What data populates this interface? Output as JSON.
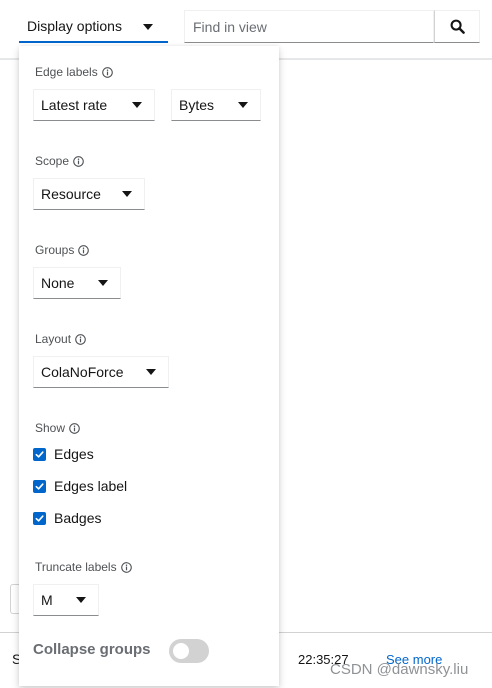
{
  "toolbar": {
    "display_options_label": "Display options",
    "search_placeholder": "Find in view"
  },
  "panel": {
    "edge_labels": {
      "label": "Edge labels",
      "primary_value": "Latest rate",
      "unit_value": "Bytes"
    },
    "scope": {
      "label": "Scope",
      "value": "Resource"
    },
    "groups": {
      "label": "Groups",
      "value": "None"
    },
    "layout": {
      "label": "Layout",
      "value": "ColaNoForce"
    },
    "show": {
      "label": "Show",
      "items": [
        {
          "label": "Edges",
          "checked": true
        },
        {
          "label": "Edges label",
          "checked": true
        },
        {
          "label": "Badges",
          "checked": true
        }
      ]
    },
    "truncate_labels": {
      "label": "Truncate labels",
      "value": "M"
    },
    "collapse_groups": {
      "label": "Collapse groups",
      "enabled": false
    }
  },
  "bottom_bar": {
    "partial_text": "S",
    "timestamp": "22:35:27",
    "link_label": "See more"
  },
  "watermark": "CSDN @dawnsky.liu",
  "colors": {
    "accent": "#0066cc",
    "checkbox": "#0066cc",
    "toggle_off": "#d2d2d2",
    "label_gray": "#4f5255"
  },
  "icons": {
    "display_caret": "caret-down-icon",
    "search": "search-icon",
    "info": "info-circle-icon",
    "check": "check-icon"
  }
}
